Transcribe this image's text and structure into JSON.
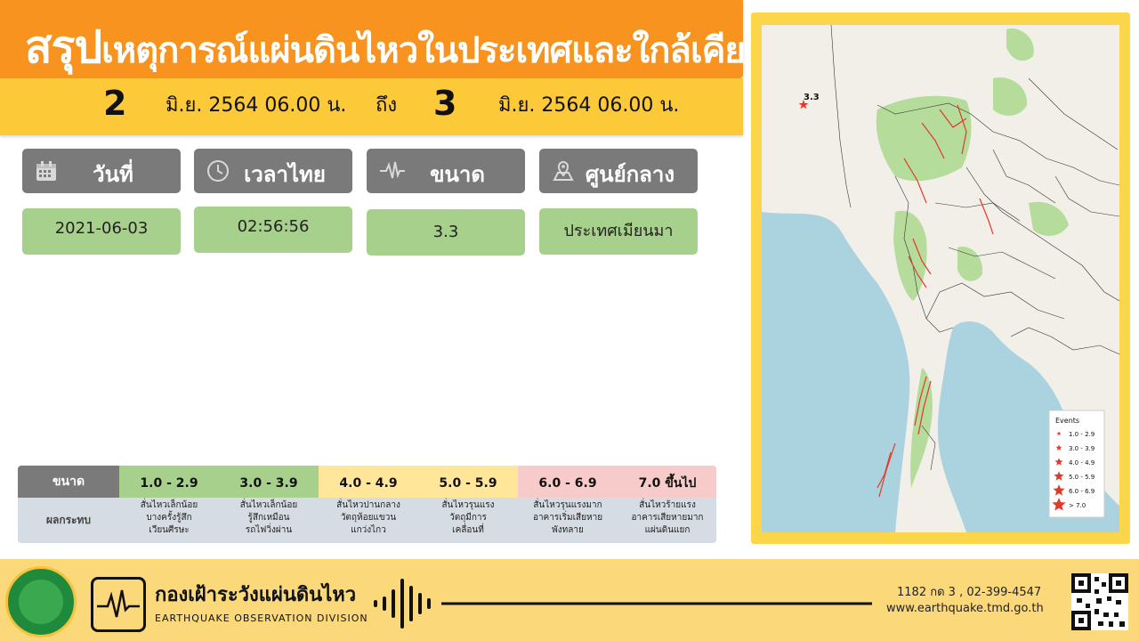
{
  "title": {
    "first": "สรุป",
    "rest": "เหตุการณ์แผ่นดินไหวในประเทศและใกล้เคียง"
  },
  "period": {
    "start_day": "2",
    "start_text": "มิ.ย. 2564  06.00  น.",
    "to": "ถึง",
    "end_day": "3",
    "end_text": "มิ.ย. 2564   06.00  น."
  },
  "headers": {
    "date": "วันที่",
    "time": "เวลาไทย",
    "magnitude": "ขนาด",
    "epicenter": "ศูนย์กลาง"
  },
  "event": {
    "date": "2021-06-03",
    "time": "02:56:56",
    "magnitude": "3.3",
    "epicenter": "ประเทศเมียนมา"
  },
  "scale": {
    "magnitude_label": "ขนาด",
    "effect_label": "ผลกระทบ",
    "levels": [
      {
        "range": "1.0 - 2.9",
        "effect": [
          "สั่นไหวเล็กน้อย",
          "บางครั้งรู้สึก",
          "เวียนศีรษะ"
        ],
        "color": "#a8d08d"
      },
      {
        "range": "3.0 - 3.9",
        "effect": [
          "สั่นไหวเล็กน้อย",
          "รู้สึกเหมือน",
          "รถไฟวิ่งผ่าน"
        ],
        "color": "#a8d08d"
      },
      {
        "range": "4.0 - 4.9",
        "effect": [
          "สั่นไหวปานกลาง",
          "วัตถุห้อยแขวน",
          "แกว่งไกว"
        ],
        "color": "#ffe699"
      },
      {
        "range": "5.0 - 5.9",
        "effect": [
          "สั่นไหวรุนแรง",
          "วัตถุมีการ",
          "เคลื่อนที่"
        ],
        "color": "#ffe699"
      },
      {
        "range": "6.0 - 6.9",
        "effect": [
          "สั่นไหวรุนแรงมาก",
          "อาคารเริ่มเสียหาย",
          "พังทลาย"
        ],
        "color": "#f8cbcb"
      },
      {
        "range": "7.0 ขึ้นไป",
        "effect": [
          "สั่นไหวร้ายแรง",
          "อาคารเสียหายมาก",
          "แผ่นดินแยก"
        ],
        "color": "#f8cbcb"
      }
    ]
  },
  "map": {
    "event_label": "3.3",
    "legend_title": "Events",
    "legend_items": [
      "1.0 - 2.9",
      "3.0 - 3.9",
      "4.0 - 4.9",
      "5.0 - 5.9",
      "6.0 - 6.9",
      "> 7.0"
    ],
    "colors": {
      "water": "#aad3df",
      "land": "#f2efe9",
      "forest": "#b5dc9b",
      "fault": "#e03a2a"
    }
  },
  "footer": {
    "division_th": "กองเฝ้าระวังแผ่นดินไหว",
    "division_en": "EARTHQUAKE OBSERVATION DIVISION",
    "phone": "1182 กด 3 , 02-399-4547",
    "website": "www.earthquake.tmd.go.th"
  },
  "colors": {
    "orange": "#f7931e",
    "yellow": "#fcc939",
    "gray": "#7a7a7a",
    "green": "#a8d08d"
  }
}
